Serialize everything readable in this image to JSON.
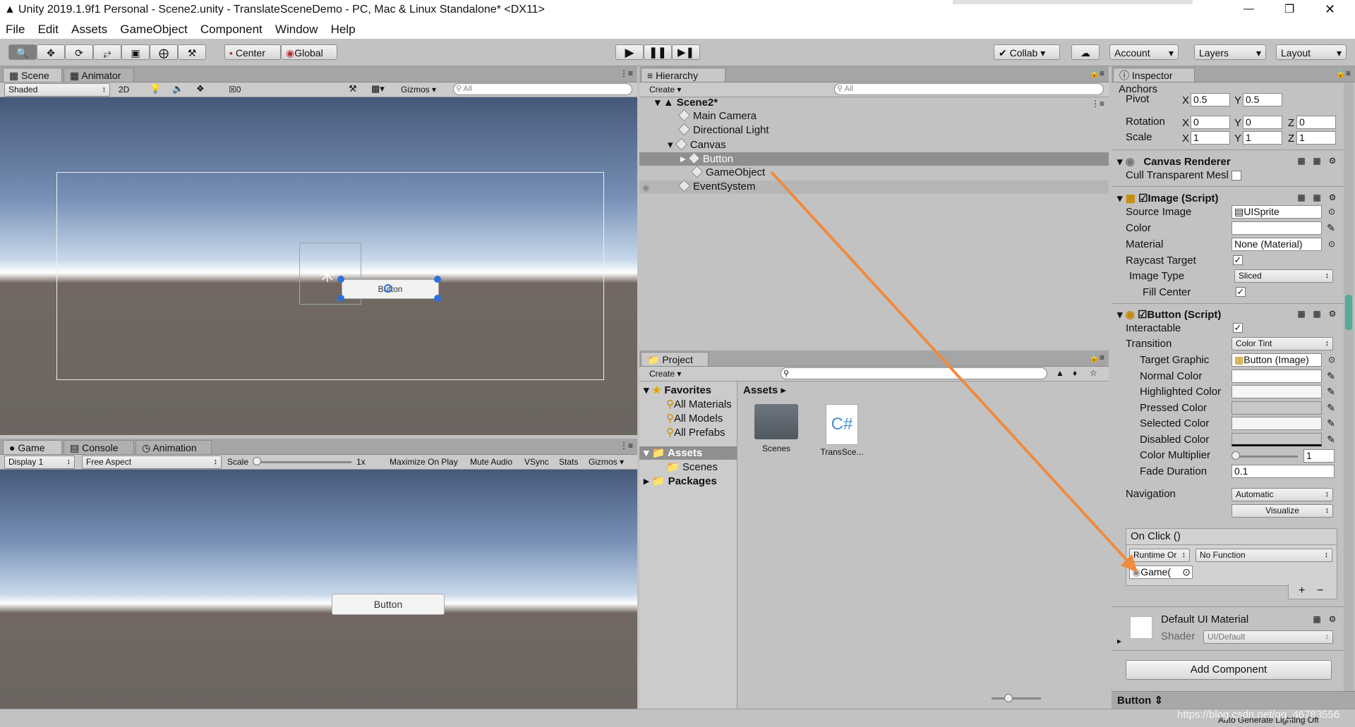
{
  "window": {
    "title": "Unity 2019.1.9f1 Personal - Scene2.unity - TranslateSceneDemo - PC, Mac & Linux Standalone* <DX11>",
    "minimize": "—",
    "restore": "❐",
    "close": "✕"
  },
  "menu": [
    "File",
    "Edit",
    "Assets",
    "GameObject",
    "Component",
    "Window",
    "Help"
  ],
  "toolbar": {
    "center": "Center",
    "global": "Global",
    "collab": "Collab",
    "account": "Account",
    "layers": "Layers",
    "layout": "Layout"
  },
  "scene": {
    "tab_scene": "Scene",
    "tab_animator": "Animator",
    "shaded": "Shaded",
    "mode_2d": "2D",
    "hidden_count": "0",
    "gizmos": "Gizmos",
    "search_placeholder": "All",
    "button_text": "Button"
  },
  "game": {
    "tab_game": "Game",
    "tab_console": "Console",
    "tab_animation": "Animation",
    "display": "Display 1",
    "aspect": "Free Aspect",
    "scale_label": "Scale",
    "scale_value": "1x",
    "maximize": "Maximize On Play",
    "mute": "Mute Audio",
    "vsync": "VSync",
    "stats": "Stats",
    "gizmos": "Gizmos",
    "button_text": "Button"
  },
  "hierarchy": {
    "tab": "Hierarchy",
    "create": "Create",
    "search_placeholder": "All",
    "scene_name": "Scene2*",
    "items": [
      "Main Camera",
      "Directional Light",
      "Canvas",
      "Button",
      "GameObject",
      "EventSystem"
    ]
  },
  "project": {
    "tab": "Project",
    "create": "Create",
    "favorites": "Favorites",
    "favorite_items": [
      "All Materials",
      "All Models",
      "All Prefabs"
    ],
    "assets_folder": "Assets",
    "scenes_folder": "Scenes",
    "packages": "Packages",
    "breadcrumb": "Assets",
    "files": [
      {
        "name": "Scenes",
        "kind": "folder"
      },
      {
        "name": "TransSce...",
        "kind": "script"
      }
    ],
    "script_glyph": "C#"
  },
  "inspector": {
    "tab": "Inspector",
    "anchors": "Anchors",
    "pivot_label": "Pivot",
    "pivot_x": "0.5",
    "pivot_y": "0.5",
    "rotation_label": "Rotation",
    "rot_x": "0",
    "rot_y": "0",
    "rot_z": "0",
    "scale_label": "Scale",
    "scale_x": "1",
    "scale_y": "1",
    "scale_z": "1",
    "axis_x": "X",
    "axis_y": "Y",
    "axis_z": "Z",
    "canvas_renderer": "Canvas Renderer",
    "cull_transparent": "Cull Transparent Mesl",
    "image_script": "Image (Script)",
    "source_image_label": "Source Image",
    "source_image": "UISprite",
    "color_label": "Color",
    "material_label": "Material",
    "material": "None (Material)",
    "raycast_label": "Raycast Target",
    "image_type_label": "Image Type",
    "image_type": "Sliced",
    "fill_center_label": "Fill Center",
    "button_script": "Button (Script)",
    "interactable_label": "Interactable",
    "transition_label": "Transition",
    "transition": "Color Tint",
    "target_graphic_label": "Target Graphic",
    "target_graphic": "Button (Image)",
    "normal_color": "Normal Color",
    "highlighted_color": "Highlighted Color",
    "pressed_color": "Pressed Color",
    "selected_color": "Selected Color",
    "disabled_color": "Disabled Color",
    "color_multiplier_label": "Color Multiplier",
    "color_multiplier": "1",
    "fade_duration_label": "Fade Duration",
    "fade_duration": "0.1",
    "navigation_label": "Navigation",
    "navigation": "Automatic",
    "visualize": "Visualize",
    "onclick": "On Click ()",
    "runtime": "Runtime Or",
    "no_function": "No Function",
    "object_field": "Game(",
    "plus": "+",
    "minus": "−",
    "default_material": "Default UI Material",
    "shader_label": "Shader",
    "shader": "UI/Default",
    "add_component": "Add Component",
    "footer_name": "Button"
  },
  "status": {
    "watermark": "https://blog.csdn.net/qq_46783556",
    "auto_lighting": "Auto Generate Lighting Off"
  },
  "colors": {
    "accent_arrow": "#f08a3e",
    "selection": "#8f8f8f",
    "panel": "#c2c2c2"
  }
}
